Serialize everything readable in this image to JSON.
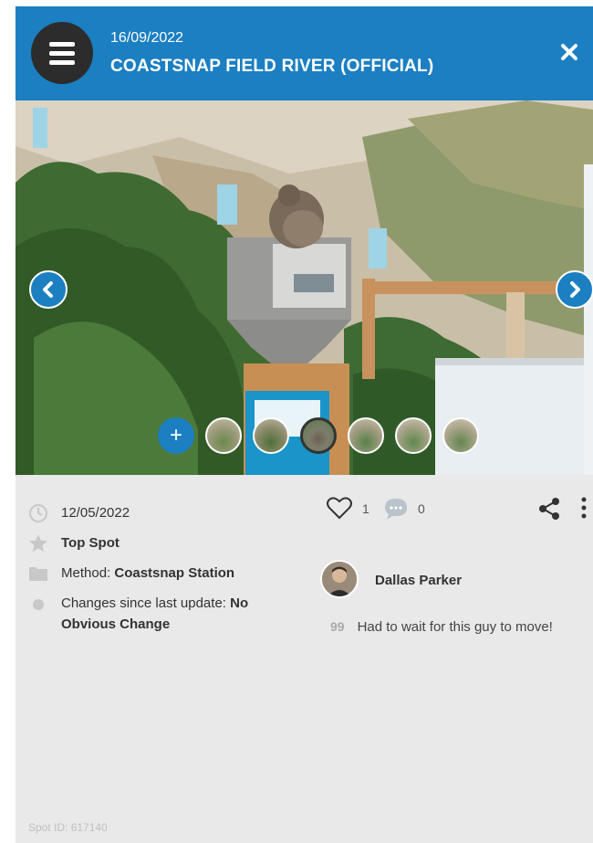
{
  "header": {
    "date": "16/09/2022",
    "title": "COASTSNAP FIELD RIVER (OFFICIAL)",
    "menu_icon": "hamburger-icon",
    "close_icon": "close-icon",
    "color": "#1b7fc1"
  },
  "photo": {
    "prev_icon": "chevron-left-icon",
    "next_icon": "chevron-right-icon",
    "add_label": "+",
    "thumbnail_count": 6,
    "active_thumbnail": 2
  },
  "details": {
    "photo_date": "12/05/2022",
    "top_spot": "Top Spot",
    "method_label": "Method:",
    "method_value": "Coastsnap Station",
    "changes_label": "Changes since last update:",
    "changes_value_line1": "No",
    "changes_value_line2": "Obvious Change",
    "likes": "1",
    "comments": "0",
    "user_name": "Dallas Parker",
    "quote_mark": "99",
    "caption": "Had to wait for this guy to move!",
    "spot_id": "Spot ID: 617140"
  }
}
